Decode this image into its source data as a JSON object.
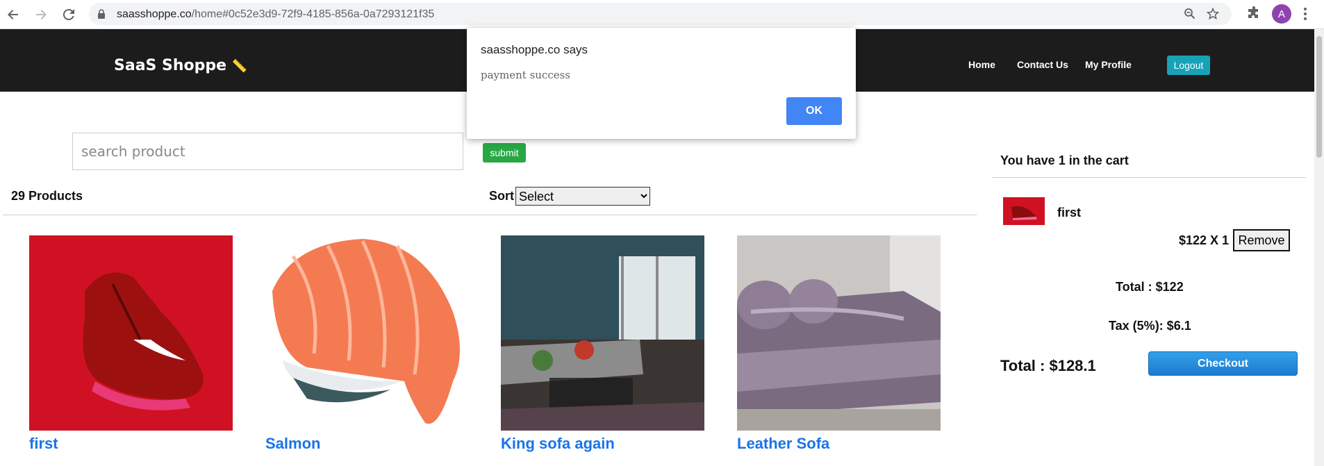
{
  "browser": {
    "url_host": "saasshoppe.co",
    "url_path": "/home#0c52e3d9-72f9-4185-856a-0a7293121f35",
    "avatar_letter": "A",
    "icons": [
      "back-icon",
      "forward-icon",
      "reload-icon",
      "lock-icon",
      "zoom-icon",
      "star-icon",
      "extensions-icon",
      "menu-icon"
    ]
  },
  "header": {
    "brand": "SaaS Shoppe",
    "nav": [
      "Home",
      "Contact Us",
      "My Profile"
    ],
    "logout": "Logout"
  },
  "search": {
    "placeholder": "search product",
    "submit": "submit"
  },
  "listing": {
    "count": "29 Products",
    "sort_label": "Sort",
    "sort_selected": "Select"
  },
  "products": [
    {
      "name": "first",
      "color": "#d01124"
    },
    {
      "name": "Salmon",
      "color": "#f47a52"
    },
    {
      "name": "King sofa again",
      "color": "#2f4f5a"
    },
    {
      "name": "Leather Sofa",
      "color": "#7b6b80"
    }
  ],
  "cart": {
    "title": "You have 1 in the cart",
    "item_name": "first",
    "item_price": "$122 X 1",
    "remove": "Remove",
    "total": "Total : $122",
    "tax": "Tax (5%): $6.1",
    "grand_total": "Total : $128.1",
    "checkout": "Checkout"
  },
  "dialog": {
    "title": "saasshoppe.co says",
    "message": "payment success",
    "ok": "OK"
  }
}
